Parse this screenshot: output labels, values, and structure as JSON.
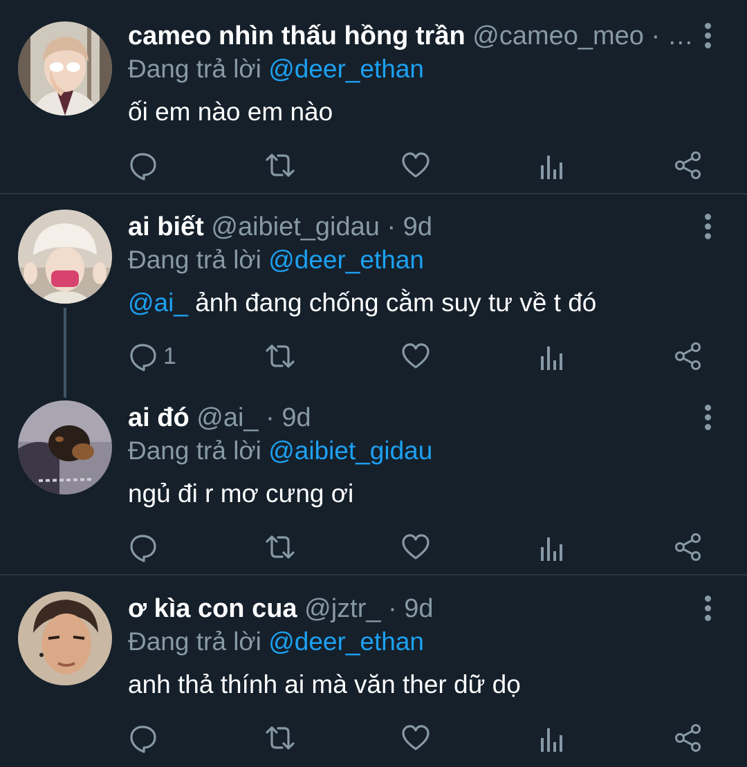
{
  "tweets": [
    {
      "name": "cameo nhìn thấu hồng trần",
      "handle": "@cameo_meo",
      "time_sep": "· …",
      "reply_label": "Đang trả lời",
      "reply_to": "@deer_ethan",
      "text_mention": "",
      "text": "ối em nào em nào",
      "reply_count": ""
    },
    {
      "name": "ai biết",
      "handle": "@aibiet_gidau",
      "time_sep": "· 9d",
      "reply_label": "Đang trả lời",
      "reply_to": "@deer_ethan",
      "text_mention": "@ai_",
      "text": " ảnh đang chống cằm suy tư về t đó",
      "reply_count": "1"
    },
    {
      "name": "ai đó",
      "handle": "@ai_",
      "time_sep": "· 9d",
      "reply_label": "Đang trả lời",
      "reply_to": "@aibiet_gidau",
      "text_mention": "",
      "text": "ngủ đi r mơ cưng ơi",
      "reply_count": ""
    },
    {
      "name": "ơ kìa con cua",
      "handle": "@jztr_",
      "time_sep": "· 9d",
      "reply_label": "Đang trả lời",
      "reply_to": "@deer_ethan",
      "text_mention": "",
      "text": "anh thả thính ai mà văn ther dữ dọ",
      "reply_count": ""
    }
  ],
  "icons": {
    "reply": "reply-icon",
    "retweet": "retweet-icon",
    "like": "heart-icon",
    "analytics": "analytics-icon",
    "share": "share-icon",
    "more": "more-vertical-icon"
  },
  "colors": {
    "background": "#15202b",
    "secondary_text": "#8899a6",
    "link": "#1da1f2",
    "divider": "#2b3640"
  }
}
